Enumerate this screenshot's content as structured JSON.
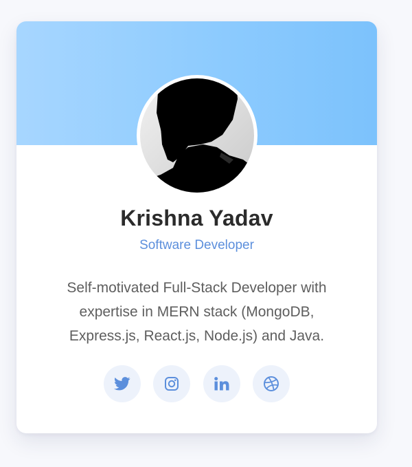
{
  "profile": {
    "name": "Krishna Yadav",
    "role": "Software Developer",
    "bio": "Self-motivated Full-Stack Developer with expertise in MERN stack (MongoDB, Express.js, React.js, Node.js) and Java."
  },
  "socials": [
    {
      "icon": "twitter-icon"
    },
    {
      "icon": "instagram-icon"
    },
    {
      "icon": "linkedin-icon"
    },
    {
      "icon": "dribbble-icon"
    }
  ],
  "colors": {
    "accent": "#5c8fdc",
    "banner_start": "#a7d6ff",
    "banner_end": "#7cc2fc",
    "icon_bg": "#edf2fb"
  }
}
